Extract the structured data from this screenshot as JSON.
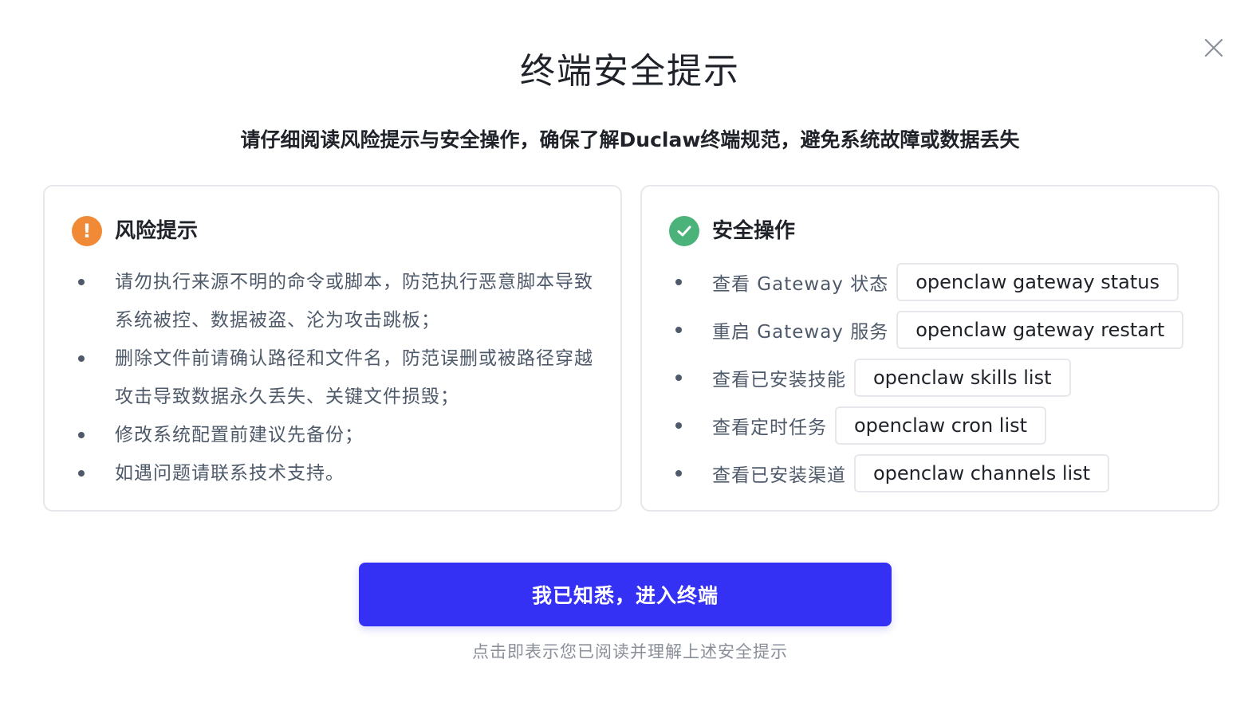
{
  "dialog": {
    "title": "终端安全提示",
    "subtitle": "请仔细阅读风险提示与安全操作，确保了解Duclaw终端规范，避免系统故障或数据丢失",
    "close_icon": "close-icon"
  },
  "risk_card": {
    "icon": "warning-icon",
    "icon_glyph": "!",
    "icon_color": "#f08a36",
    "title": "风险提示",
    "items": [
      "请勿执行来源不明的命令或脚本，防范执行恶意脚本导致系统被控、数据被盗、沦为攻击跳板；",
      "删除文件前请确认路径和文件名，防范误删或被路径穿越攻击导致数据永久丢失、关键文件损毁；",
      "修改系统配置前建议先备份；",
      "如遇问题请联系技术支持。"
    ]
  },
  "safe_card": {
    "icon": "check-icon",
    "icon_color": "#4bb37a",
    "title": "安全操作",
    "items": [
      {
        "label": "查看 Gateway 状态",
        "command": "openclaw gateway status"
      },
      {
        "label": "重启 Gateway 服务",
        "command": "openclaw gateway restart"
      },
      {
        "label": "查看已安装技能",
        "command": "openclaw skills list"
      },
      {
        "label": "查看定时任务",
        "command": "openclaw cron list"
      },
      {
        "label": "查看已安装渠道",
        "command": "openclaw channels list"
      }
    ]
  },
  "confirm": {
    "label": "我已知悉，进入终端",
    "color": "#3431f5"
  },
  "footer_hint": "点击即表示您已阅读并理解上述安全提示"
}
